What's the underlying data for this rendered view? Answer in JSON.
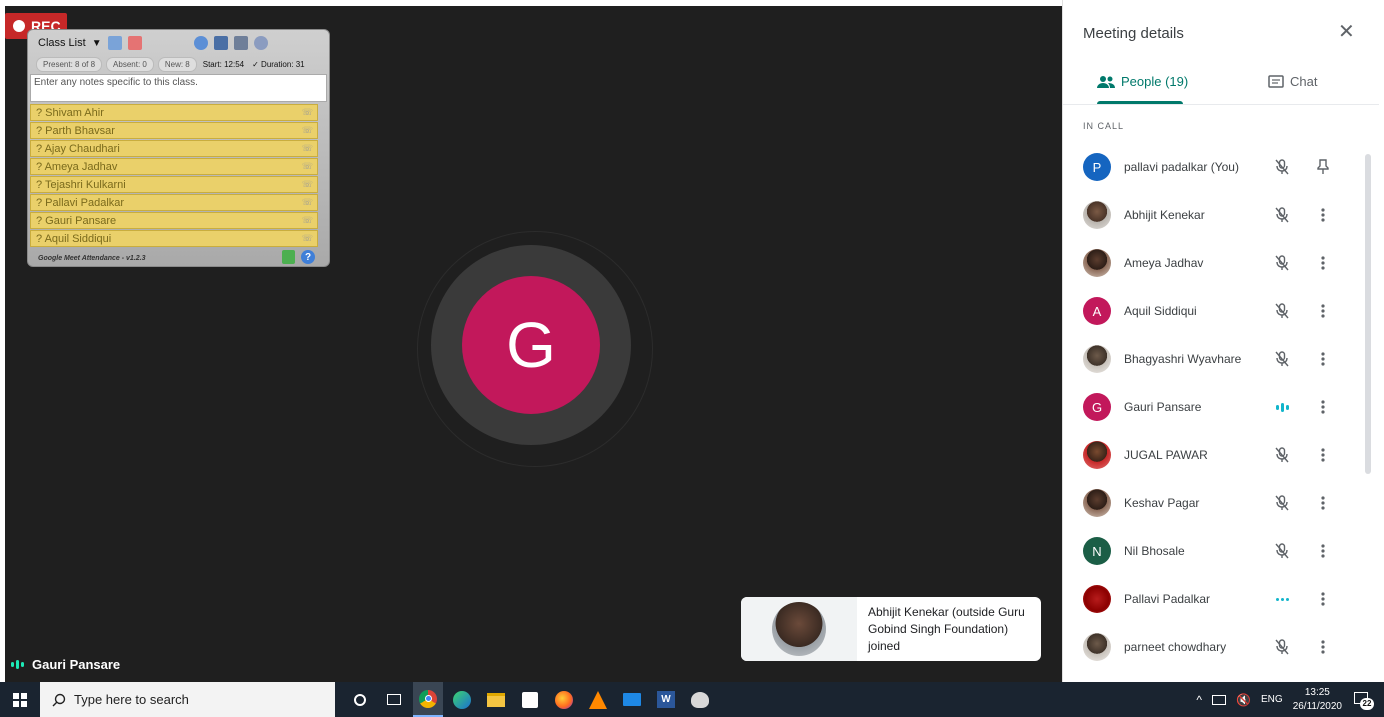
{
  "recording": {
    "label": "REC"
  },
  "main_stage": {
    "avatar_letter": "G",
    "avatar_color": "#c2185b",
    "speaker_name": "Gauri Pansare"
  },
  "class_list": {
    "title": "Class List",
    "stats": {
      "present": "Present: 8 of 8",
      "absent": "Absent: 0",
      "new": "New: 8",
      "start": "Start: 12:54",
      "duration": "✓ Duration: 31"
    },
    "notes_placeholder": "Enter any notes specific to this class.",
    "students": [
      "? Shivam Ahir",
      "? Parth Bhavsar",
      "? Ajay Chaudhari",
      "? Ameya Jadhav",
      "? Tejashri Kulkarni",
      "? Pallavi Padalkar",
      "? Gauri Pansare",
      "? Aquil Siddiqui"
    ],
    "footer": "Google Meet Attendance - v1.2.3",
    "help_label": "?"
  },
  "toast": {
    "message": "Abhijit Kenekar (outside Guru Gobind Singh Foundation) joined"
  },
  "panel": {
    "title": "Meeting details",
    "close_icon": "✕",
    "tabs": {
      "people": "People (19)",
      "chat": "Chat"
    },
    "section_label": "IN CALL",
    "participants": [
      {
        "name": "pallavi padalkar (You)",
        "avatar": "P",
        "color": "#1565c0",
        "mic": "muted",
        "action": "pin"
      },
      {
        "name": "Abhijit Kenekar",
        "avatar": "",
        "mic": "muted",
        "action": "more"
      },
      {
        "name": "Ameya Jadhav",
        "avatar": "",
        "mic": "muted",
        "action": "more"
      },
      {
        "name": "Aquil Siddiqui",
        "avatar": "A",
        "color": "#c2185b",
        "mic": "muted",
        "action": "more"
      },
      {
        "name": "Bhagyashri Wyavhare",
        "avatar": "",
        "mic": "muted",
        "action": "more"
      },
      {
        "name": "Gauri Pansare",
        "avatar": "G",
        "color": "#c2185b",
        "mic": "speaking",
        "action": "more"
      },
      {
        "name": "JUGAL PAWAR",
        "avatar": "",
        "mic": "muted",
        "action": "more"
      },
      {
        "name": "Keshav Pagar",
        "avatar": "",
        "mic": "muted",
        "action": "more"
      },
      {
        "name": "Nil Bhosale",
        "avatar": "N",
        "color": "#1b5e46",
        "mic": "muted",
        "action": "more"
      },
      {
        "name": "Pallavi Padalkar",
        "avatar": "",
        "mic": "active",
        "action": "more"
      },
      {
        "name": "parneet chowdhary",
        "avatar": "",
        "mic": "muted",
        "action": "more"
      }
    ]
  },
  "taskbar": {
    "search_placeholder": "Type here to search",
    "language": "ENG",
    "time": "13:25",
    "date": "26/11/2020",
    "notification_count": "22"
  }
}
